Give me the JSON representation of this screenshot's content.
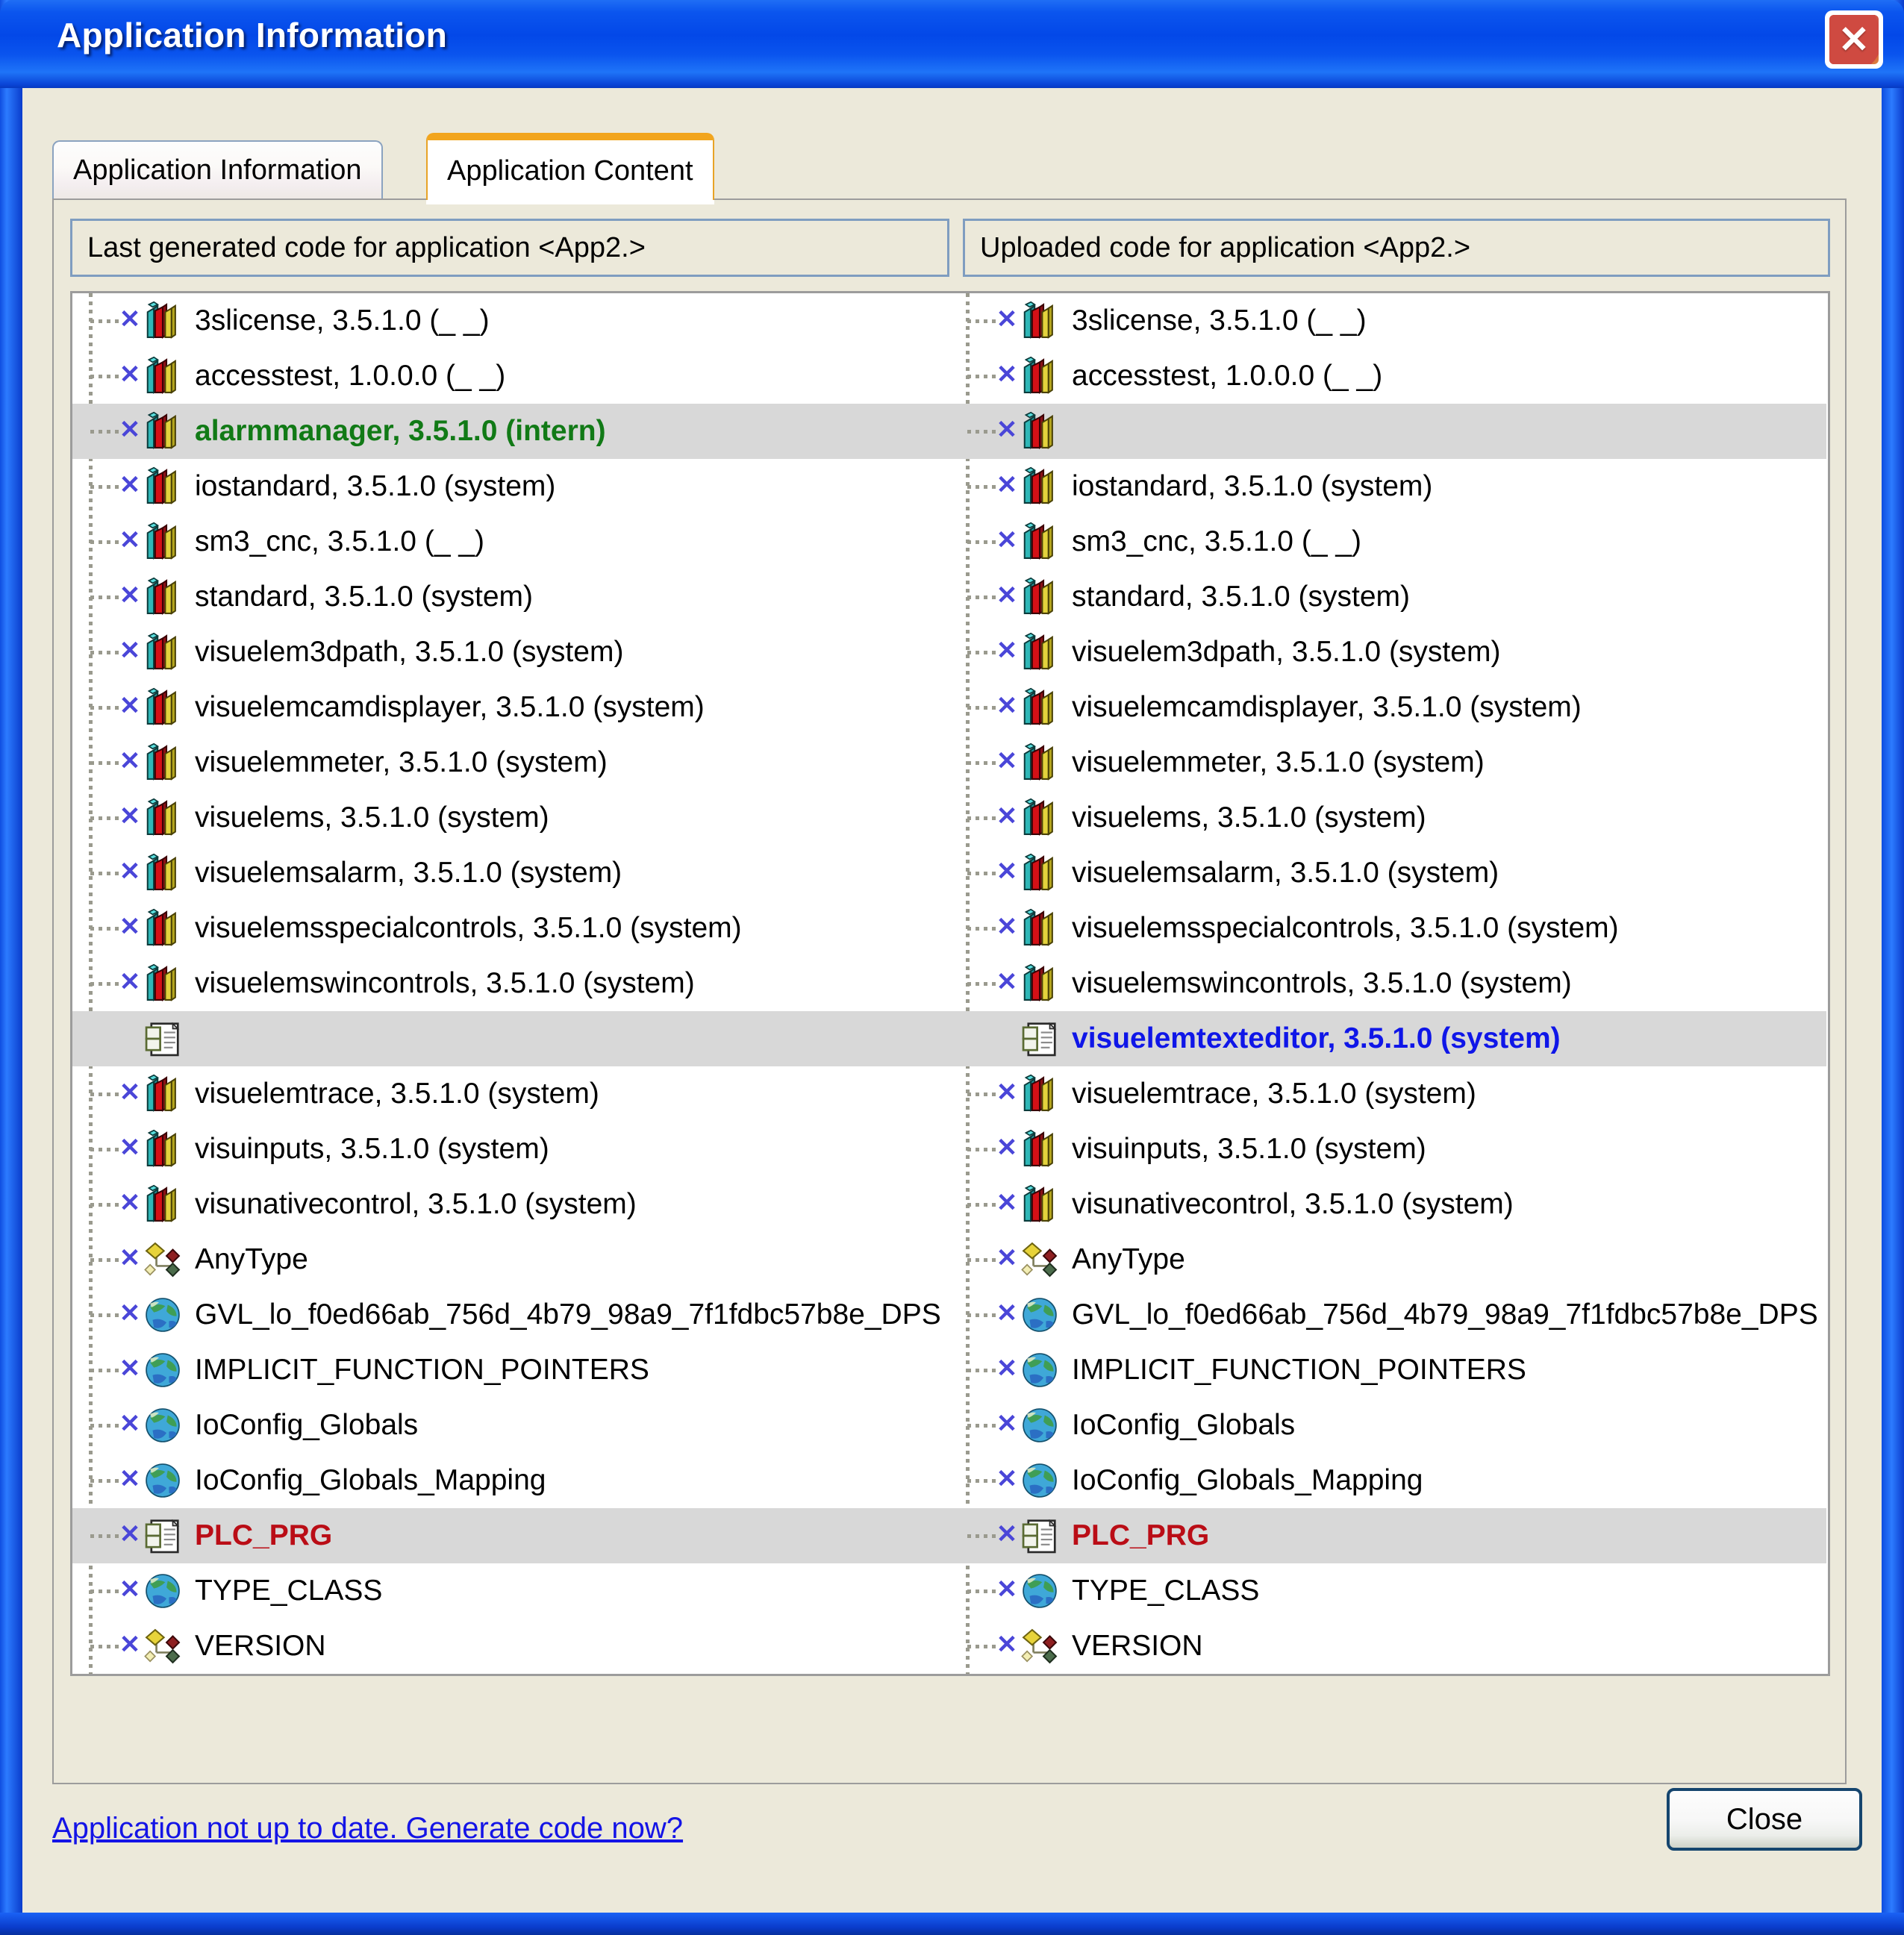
{
  "window": {
    "title": "Application Information",
    "close_icon": "close-window-icon"
  },
  "tabs": [
    {
      "label": "Application Information",
      "active": false
    },
    {
      "label": "Application Content",
      "active": true
    }
  ],
  "columns": {
    "left_header": "Last generated code for application <App2.>",
    "right_header": "Uploaded code for application <App2.>"
  },
  "colors": {
    "added_green": "#117a16",
    "added_blue": "#0f16e8",
    "changed_red": "#ba0d16",
    "selection_gray": "#d8d8d8",
    "link_blue": "#1414e6",
    "tab_accent_orange": "#f2a51d"
  },
  "tree_left": [
    {
      "label": "3slicense, 3.5.1.0 (_ _)",
      "icon": "library-icon",
      "style": "normal",
      "selected": false
    },
    {
      "label": "accesstest, 1.0.0.0 (_ _)",
      "icon": "library-icon",
      "style": "normal",
      "selected": false
    },
    {
      "label": "alarmmanager, 3.5.1.0 (intern)",
      "icon": "library-icon",
      "style": "green",
      "selected": true
    },
    {
      "label": "iostandard, 3.5.1.0 (system)",
      "icon": "library-icon",
      "style": "normal",
      "selected": false
    },
    {
      "label": "sm3_cnc, 3.5.1.0 (_ _)",
      "icon": "library-icon",
      "style": "normal",
      "selected": false
    },
    {
      "label": "standard, 3.5.1.0 (system)",
      "icon": "library-icon",
      "style": "normal",
      "selected": false
    },
    {
      "label": "visuelem3dpath, 3.5.1.0 (system)",
      "icon": "library-icon",
      "style": "normal",
      "selected": false
    },
    {
      "label": "visuelemcamdisplayer, 3.5.1.0 (system)",
      "icon": "library-icon",
      "style": "normal",
      "selected": false
    },
    {
      "label": "visuelemmeter, 3.5.1.0 (system)",
      "icon": "library-icon",
      "style": "normal",
      "selected": false
    },
    {
      "label": "visuelems, 3.5.1.0 (system)",
      "icon": "library-icon",
      "style": "normal",
      "selected": false
    },
    {
      "label": "visuelemsalarm, 3.5.1.0 (system)",
      "icon": "library-icon",
      "style": "normal",
      "selected": false
    },
    {
      "label": "visuelemsspecialcontrols, 3.5.1.0 (system)",
      "icon": "library-icon",
      "style": "normal",
      "selected": false
    },
    {
      "label": "visuelemswincontrols, 3.5.1.0 (system)",
      "icon": "library-icon",
      "style": "normal",
      "selected": false
    },
    {
      "label": "",
      "icon": "program-icon",
      "style": "normal",
      "selected": true,
      "no_connector": true
    },
    {
      "label": "visuelemtrace, 3.5.1.0 (system)",
      "icon": "library-icon",
      "style": "normal",
      "selected": false
    },
    {
      "label": "visuinputs, 3.5.1.0 (system)",
      "icon": "library-icon",
      "style": "normal",
      "selected": false
    },
    {
      "label": "visunativecontrol, 3.5.1.0 (system)",
      "icon": "library-icon",
      "style": "normal",
      "selected": false
    },
    {
      "label": "AnyType",
      "icon": "datatype-icon",
      "style": "normal",
      "selected": false
    },
    {
      "label": "GVL_lo_f0ed66ab_756d_4b79_98a9_7f1fdbc57b8e_DPS",
      "icon": "globals-icon",
      "style": "normal",
      "selected": false
    },
    {
      "label": "IMPLICIT_FUNCTION_POINTERS",
      "icon": "globals-icon",
      "style": "normal",
      "selected": false
    },
    {
      "label": "IoConfig_Globals",
      "icon": "globals-icon",
      "style": "normal",
      "selected": false
    },
    {
      "label": "IoConfig_Globals_Mapping",
      "icon": "globals-icon",
      "style": "normal",
      "selected": false
    },
    {
      "label": "PLC_PRG",
      "icon": "program-icon",
      "style": "red",
      "selected": true
    },
    {
      "label": "TYPE_CLASS",
      "icon": "globals-icon",
      "style": "normal",
      "selected": false
    },
    {
      "label": "VERSION",
      "icon": "datatype-icon",
      "style": "normal",
      "selected": false
    }
  ],
  "tree_right": [
    {
      "label": "3slicense, 3.5.1.0 (_ _)",
      "icon": "library-icon",
      "style": "normal",
      "selected": false
    },
    {
      "label": "accesstest, 1.0.0.0 (_ _)",
      "icon": "library-icon",
      "style": "normal",
      "selected": false
    },
    {
      "label": "",
      "icon": "library-icon",
      "style": "normal",
      "selected": true
    },
    {
      "label": "iostandard, 3.5.1.0 (system)",
      "icon": "library-icon",
      "style": "normal",
      "selected": false
    },
    {
      "label": "sm3_cnc, 3.5.1.0 (_ _)",
      "icon": "library-icon",
      "style": "normal",
      "selected": false
    },
    {
      "label": "standard, 3.5.1.0 (system)",
      "icon": "library-icon",
      "style": "normal",
      "selected": false
    },
    {
      "label": "visuelem3dpath, 3.5.1.0 (system)",
      "icon": "library-icon",
      "style": "normal",
      "selected": false
    },
    {
      "label": "visuelemcamdisplayer, 3.5.1.0 (system)",
      "icon": "library-icon",
      "style": "normal",
      "selected": false
    },
    {
      "label": "visuelemmeter, 3.5.1.0 (system)",
      "icon": "library-icon",
      "style": "normal",
      "selected": false
    },
    {
      "label": "visuelems, 3.5.1.0 (system)",
      "icon": "library-icon",
      "style": "normal",
      "selected": false
    },
    {
      "label": "visuelemsalarm, 3.5.1.0 (system)",
      "icon": "library-icon",
      "style": "normal",
      "selected": false
    },
    {
      "label": "visuelemsspecialcontrols, 3.5.1.0 (system)",
      "icon": "library-icon",
      "style": "normal",
      "selected": false
    },
    {
      "label": "visuelemswincontrols, 3.5.1.0 (system)",
      "icon": "library-icon",
      "style": "normal",
      "selected": false
    },
    {
      "label": "visuelemtexteditor, 3.5.1.0 (system)",
      "icon": "program-icon",
      "style": "blue",
      "selected": true,
      "no_connector": true
    },
    {
      "label": "visuelemtrace, 3.5.1.0 (system)",
      "icon": "library-icon",
      "style": "normal",
      "selected": false
    },
    {
      "label": "visuinputs, 3.5.1.0 (system)",
      "icon": "library-icon",
      "style": "normal",
      "selected": false
    },
    {
      "label": "visunativecontrol, 3.5.1.0 (system)",
      "icon": "library-icon",
      "style": "normal",
      "selected": false
    },
    {
      "label": "AnyType",
      "icon": "datatype-icon",
      "style": "normal",
      "selected": false
    },
    {
      "label": "GVL_lo_f0ed66ab_756d_4b79_98a9_7f1fdbc57b8e_DPS",
      "icon": "globals-icon",
      "style": "normal",
      "selected": false
    },
    {
      "label": "IMPLICIT_FUNCTION_POINTERS",
      "icon": "globals-icon",
      "style": "normal",
      "selected": false
    },
    {
      "label": "IoConfig_Globals",
      "icon": "globals-icon",
      "style": "normal",
      "selected": false
    },
    {
      "label": "IoConfig_Globals_Mapping",
      "icon": "globals-icon",
      "style": "normal",
      "selected": false
    },
    {
      "label": "PLC_PRG",
      "icon": "program-icon",
      "style": "red",
      "selected": true
    },
    {
      "label": "TYPE_CLASS",
      "icon": "globals-icon",
      "style": "normal",
      "selected": false
    },
    {
      "label": "VERSION",
      "icon": "datatype-icon",
      "style": "normal",
      "selected": false
    }
  ],
  "footer": {
    "link_text": "Application not up to date. Generate code now?",
    "close_label": "Close"
  }
}
